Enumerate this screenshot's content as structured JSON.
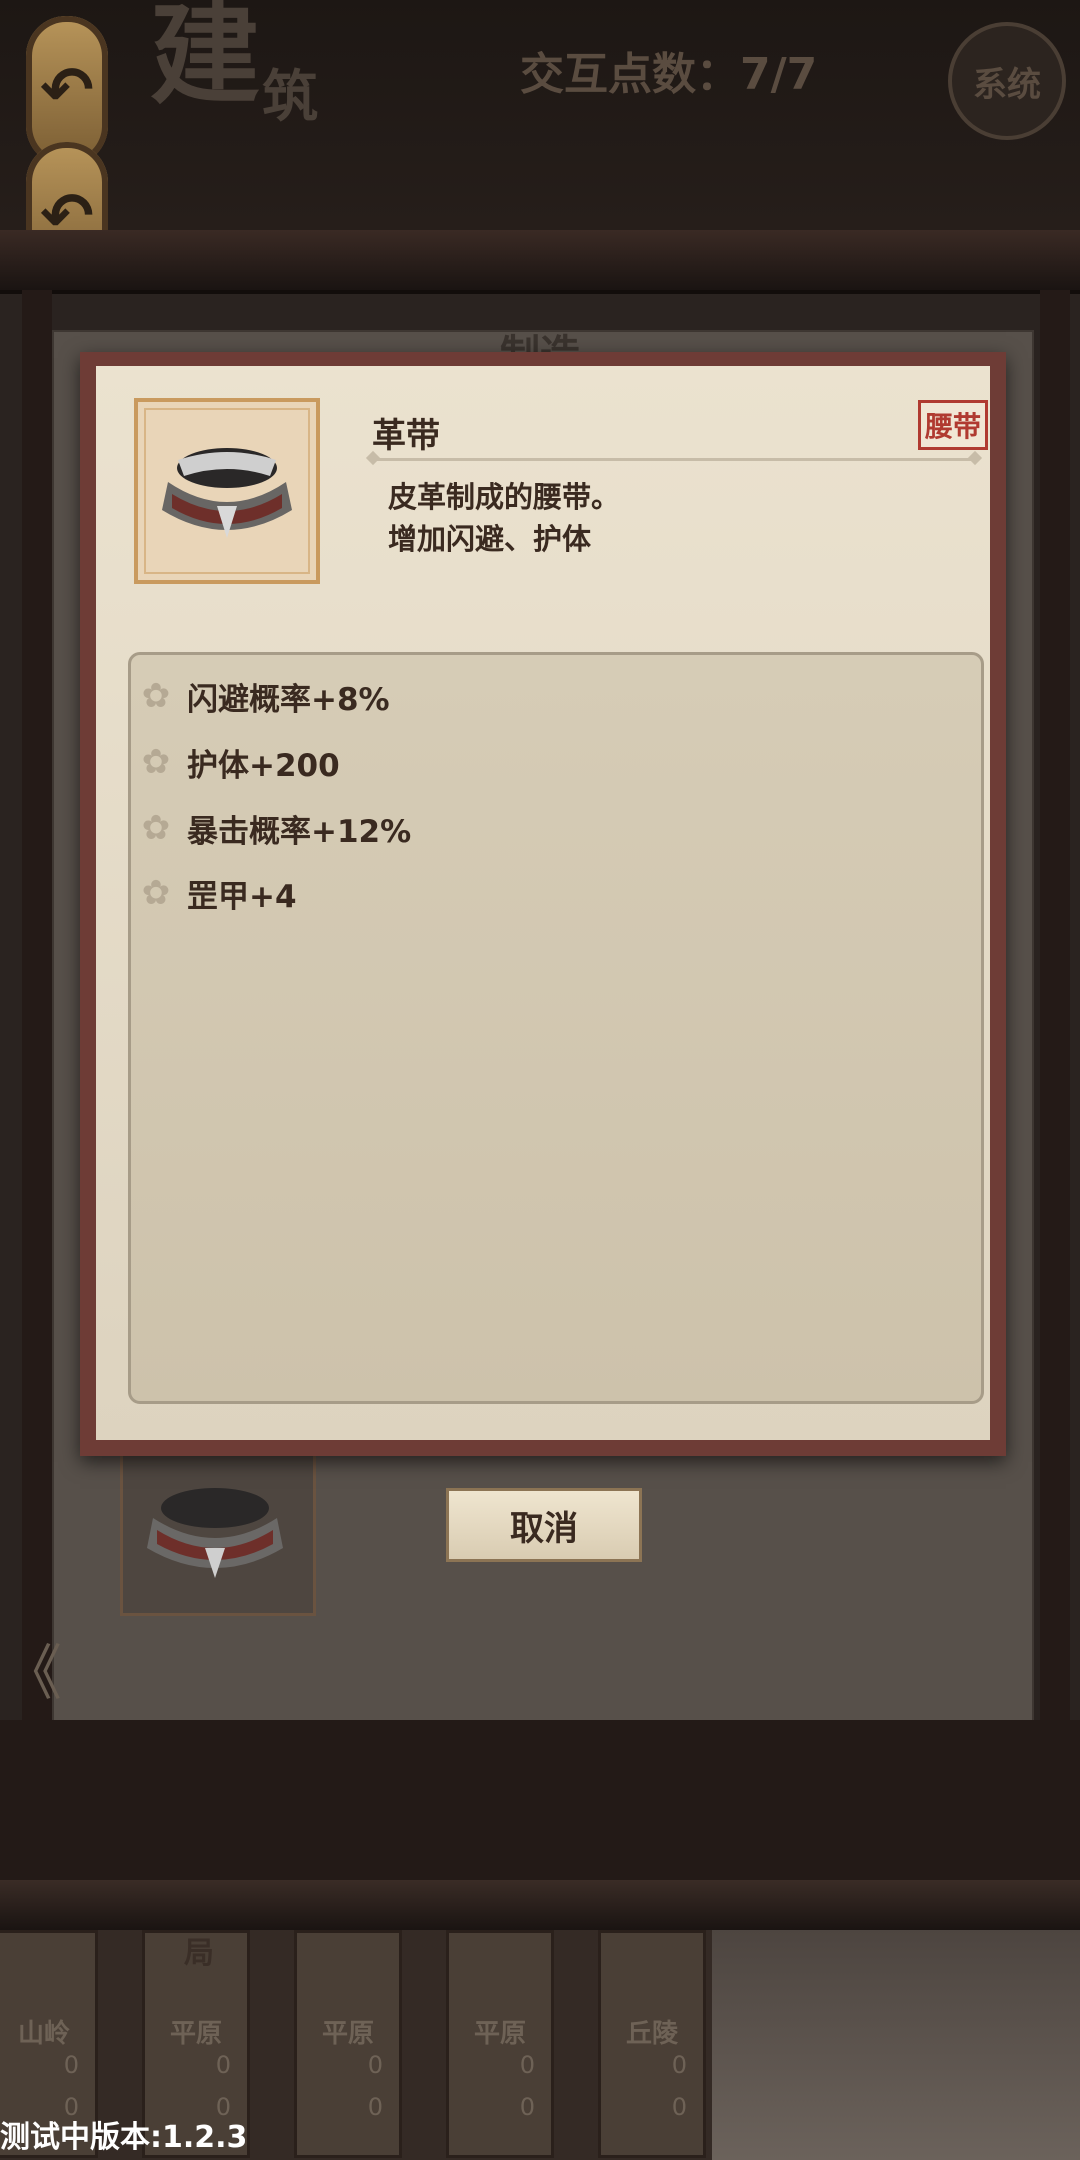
{
  "header": {
    "title_big": "建",
    "title_small": "筑",
    "points_label": "交互点数：7/7",
    "system_button": "系统",
    "back_icon": "undo-arrow-icon"
  },
  "background_panel": {
    "title": "制造",
    "cancel_label": "取消"
  },
  "dialog": {
    "item_name": "革带",
    "item_tag": "腰带",
    "description_line1": "皮革制成的腰带。",
    "description_line2": "增加闪避、护体",
    "stats": [
      {
        "icon": "flower-icon",
        "text": "闪避概率+8%"
      },
      {
        "icon": "flower-icon",
        "text": "护体+200"
      },
      {
        "icon": "flower-icon",
        "text": "暴击概率+12%"
      },
      {
        "icon": "flower-icon",
        "text": "罡甲+4"
      }
    ]
  },
  "bottom_tiles": [
    {
      "name": "山岭",
      "n1": "0",
      "n2": "0"
    },
    {
      "name": "平原",
      "n1": "0",
      "n2": "0"
    },
    {
      "name": "平原",
      "n1": "0",
      "n2": "0"
    },
    {
      "name": "平原",
      "n1": "0",
      "n2": "0"
    },
    {
      "name": "丘陵",
      "n1": "0",
      "n2": "0"
    }
  ],
  "bottom_label": "局",
  "version": "测试中版本:1.2.3",
  "colors": {
    "dialog_border": "#6e3c36",
    "tag_red": "#b03a30",
    "parchment": "#ebe2cf"
  }
}
